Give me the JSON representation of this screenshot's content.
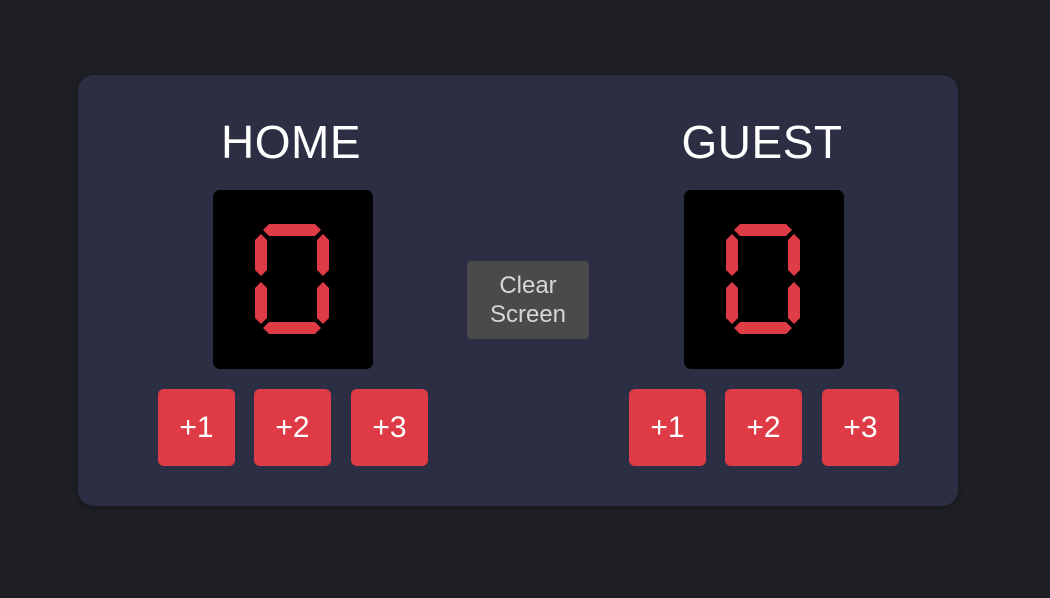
{
  "colors": {
    "page_background": "#1f2026",
    "board_background": "#2c2f43",
    "display_background": "#000000",
    "digit": "#de3b47",
    "button": "#de3b47",
    "button_text": "#ffffff",
    "clear_button": "#4a4a4a",
    "clear_button_text": "#d6d6d6"
  },
  "home": {
    "title": "HOME",
    "score": "0",
    "buttons": [
      "+1",
      "+2",
      "+3"
    ]
  },
  "guest": {
    "title": "GUEST",
    "score": "0",
    "buttons": [
      "+1",
      "+2",
      "+3"
    ]
  },
  "clear_button": {
    "line1": "Clear",
    "line2": "Screen"
  }
}
